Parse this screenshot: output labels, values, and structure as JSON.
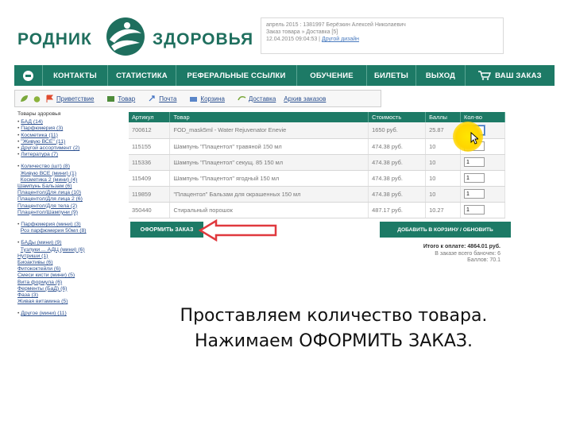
{
  "logo": {
    "left_word": "РОДНИК",
    "right_word": "ЗДОРОВЬЯ"
  },
  "userbox": {
    "line1": "апрель 2015 : 1381997 Берёзкин Алексей Николаевич",
    "line2": "Заказ товара » Доставка [5]",
    "line3": "12.04.2015 09:04:53 |",
    "design_link": "Другой дизайн"
  },
  "nav": {
    "items": [
      "КОНТАКТЫ",
      "СТАТИСТИКА",
      "РЕФЕРАЛЬНЫЕ ССЫЛКИ",
      "ОБУЧЕНИЕ",
      "БИЛЕТЫ",
      "ВЫХОД"
    ],
    "order_label": "ВАШ ЗАКАЗ"
  },
  "subbar": {
    "links": [
      "Приветствие",
      "Товар",
      "Почта",
      "Корзина",
      "Доставка",
      "Архив заказов"
    ]
  },
  "sidebar": {
    "head": "Товары здоровья",
    "group1": [
      "БАД (14)",
      "Парфюмерия (3)",
      "Косметика (11)",
      "\"Живую ВСЕ\" (11)",
      "Другой ассортимент (2)",
      "Литература (7)"
    ],
    "group2": [
      "Количество (шт) (8)",
      "Живую ВСЕ (мини) (1)",
      "Косметика 2 (мини) (4)",
      "Шампунь Бальзам (6)",
      "Плацентол/Для лица (10)",
      "Плацентол/Для лица 2 (6)",
      "Плацентол/Для тела (2)",
      "Плацентол/Шампуни (9)"
    ],
    "group3": [
      "Парфюмерия (мини) (3)",
      "Роз парфюмерия 50мл (8)"
    ],
    "group4": [
      "БАДы (мини) (9)",
      "Тузлуки ... АДЦ (мини) (6)",
      "Нутриши (1)",
      "Биоактивы (6)",
      "Фитококтейли (6)",
      "Смеси кисти (мини) (5)",
      "Вита формула (6)",
      "Ферменты (БаД) (6)",
      "Фаза (3)",
      "Живая витамина (5)"
    ],
    "group5": [
      "Другое (мини) (11)"
    ]
  },
  "table": {
    "headers": [
      "Артикул",
      "Товар",
      "Стоимость",
      "Баллы",
      "Кол-во"
    ],
    "rows": [
      {
        "sku": "700612",
        "name": "FOD_mask5ml - Water Rejuvenator Enevie",
        "price": "1650 руб.",
        "points": "25.87",
        "qty": "1"
      },
      {
        "sku": "115155",
        "name": "Шампунь \"Плацентол\" травяной 150 мл",
        "price": "474.38 руб.",
        "points": "10",
        "qty": "1"
      },
      {
        "sku": "115336",
        "name": "Шампунь \"Плацентол\" секущ. 85 150 мл",
        "price": "474.38 руб.",
        "points": "10",
        "qty": "1"
      },
      {
        "sku": "115409",
        "name": "Шампунь \"Плацентол\" ягодный 150 мл",
        "price": "474.38 руб.",
        "points": "10",
        "qty": "1"
      },
      {
        "sku": "119859",
        "name": "\"Плацентол\" Бальзам для окрашенных 150 мл",
        "price": "474.38 руб.",
        "points": "10",
        "qty": "1"
      },
      {
        "sku": "350440",
        "name": "Стиральный порошок",
        "price": "487.17 руб.",
        "points": "10.27",
        "qty": "1"
      }
    ]
  },
  "buttons": {
    "order": "ОФОРМИТЬ ЗАКАЗ",
    "add": "ДОБАВИТЬ В КОРЗИНУ / ОБНОВИТЬ"
  },
  "totals": {
    "sum": "Итого к оплате: 4864.01 руб.",
    "jars": "В заказе всего баночек: 6",
    "points": "Баллов: 70.1"
  },
  "caption": {
    "line1": "Проставляем количество товара.",
    "line2": "Нажимаем ОФОРМИТЬ ЗАКАЗ."
  },
  "colors": {
    "brand_green": "#1d7a66",
    "arrow_red": "#e0393e",
    "highlight_yellow": "#ffd500"
  }
}
